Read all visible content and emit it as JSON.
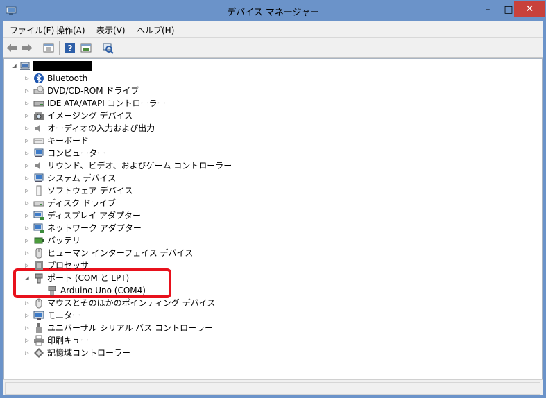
{
  "window": {
    "title": "デバイス マネージャー",
    "controls": {
      "minimize": "–",
      "maximize": "□",
      "close": "✕"
    }
  },
  "colors": {
    "frame": "#6b93c9",
    "close_button": "#c8413b",
    "highlight_box": "#e8111c"
  },
  "menu": {
    "items": [
      {
        "label": "ファイル(F)"
      },
      {
        "label": "操作(A)"
      },
      {
        "label": "表示(V)"
      },
      {
        "label": "ヘルプ(H)"
      }
    ]
  },
  "toolbar": {
    "buttons": [
      "back-arrow-icon",
      "forward-arrow-icon",
      "properties-list-icon",
      "help-icon",
      "update-driver-icon",
      "scan-hardware-icon"
    ]
  },
  "tree": {
    "root": {
      "name_redacted": true
    },
    "categories": [
      {
        "label": "Bluetooth",
        "icon": "bluetooth-icon"
      },
      {
        "label": "DVD/CD-ROM ドライブ",
        "icon": "dvd-drive-icon"
      },
      {
        "label": "IDE ATA/ATAPI コントローラー",
        "icon": "ide-controller-icon"
      },
      {
        "label": "イメージング デバイス",
        "icon": "camera-icon"
      },
      {
        "label": "オーディオの入力および出力",
        "icon": "speaker-icon"
      },
      {
        "label": "キーボード",
        "icon": "keyboard-icon"
      },
      {
        "label": "コンピューター",
        "icon": "computer-icon"
      },
      {
        "label": "サウンド、ビデオ、およびゲーム コントローラー",
        "icon": "sound-icon"
      },
      {
        "label": "システム デバイス",
        "icon": "system-device-icon"
      },
      {
        "label": "ソフトウェア デバイス",
        "icon": "software-device-icon"
      },
      {
        "label": "ディスク ドライブ",
        "icon": "disk-drive-icon"
      },
      {
        "label": "ディスプレイ アダプター",
        "icon": "display-adapter-icon"
      },
      {
        "label": "ネットワーク アダプター",
        "icon": "network-adapter-icon"
      },
      {
        "label": "バッテリ",
        "icon": "battery-icon"
      },
      {
        "label": "ヒューマン インターフェイス デバイス",
        "icon": "hid-icon"
      },
      {
        "label": "プロセッサ",
        "icon": "processor-icon"
      },
      {
        "label": "ポート (COM と LPT)",
        "icon": "port-icon",
        "expanded": true,
        "children": [
          {
            "label": "Arduino Uno (COM4)",
            "icon": "port-icon"
          }
        ]
      },
      {
        "label": "マウスとそのほかのポインティング デバイス",
        "icon": "mouse-icon"
      },
      {
        "label": "モニター",
        "icon": "monitor-icon"
      },
      {
        "label": "ユニバーサル シリアル バス コントローラー",
        "icon": "usb-icon"
      },
      {
        "label": "印刷キュー",
        "icon": "printer-icon"
      },
      {
        "label": "記憶域コントローラー",
        "icon": "storage-controller-icon"
      }
    ]
  }
}
